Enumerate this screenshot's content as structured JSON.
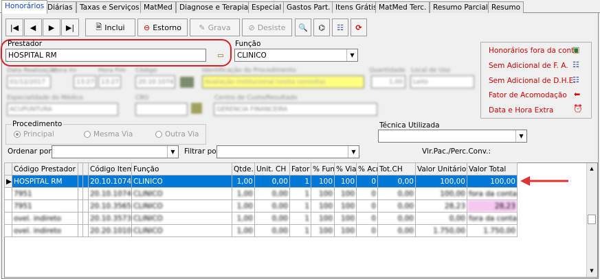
{
  "tabs": [
    "Honorários",
    "Diárias",
    "Taxas e Serviços",
    "MatMed",
    "Diagnose e Terapia",
    "Especial",
    "Gastos Part.",
    "Itens Grátis",
    "MatMed Terc.",
    "Resumo Parcial",
    "Resumo"
  ],
  "toolbar": {
    "first": "|◀",
    "prev": "◀",
    "next": "▶",
    "last": "▶|",
    "inclui": "Inclui",
    "estorno": "Estorno",
    "grava": "Grava",
    "desiste": "Desiste"
  },
  "form": {
    "prestador_label": "Prestador",
    "prestador_value": "HOSPITAL RM",
    "funcao_label": "Função",
    "funcao_value": "CLINICO",
    "data_label": "Data Realização",
    "hora_ini_label": "Hora Ini",
    "hora_fim_label": "Hora Fim",
    "codigo_label": "Código",
    "data_value": "01/12/2017",
    "hora_ini_value": "13:27",
    "hora_fim_value": "13:27",
    "codigo_value": "20.10.1074",
    "descricao_label": "Identificação do Procedimento",
    "descricao_value": "Avaliação institucional (visita consulta)",
    "quantidade_label": "Quantidade",
    "quantidade_value": "1,00",
    "local_label": "Local de Uso",
    "local_value": "Leito",
    "especialidade_label": "Especialidade do Médico",
    "especialidade_value": "ACUPUNTURA",
    "cbo_label": "CBO",
    "centro_label": "Centro de Custo/Resultado",
    "centro_value": "GERENCIA FINANCEIRA",
    "procedimento_label": "Procedimento",
    "proc_principal": "Principal",
    "proc_mesma": "Mesma Via",
    "proc_outra": "Outra Via",
    "tecnica_label": "Técnica Utilizada",
    "ordenar_label": "Ordenar por",
    "filtrar_label": "Filtrar por",
    "vlr_label": "Vlr.Pac./Perc.Conv.:"
  },
  "right_links": [
    {
      "label": "Honorários fora da conta",
      "icon": "money-icon"
    },
    {
      "label": "Sem Adicional de F. A.",
      "icon": "people-icon"
    },
    {
      "label": "Sem Adicional de D.H.E.",
      "icon": "people-icon"
    },
    {
      "label": "Fator de Acomodação",
      "icon": "arrow-left-icon"
    },
    {
      "label": "Data e Hora Extra",
      "icon": "alarm-clock-icon"
    }
  ],
  "grid": {
    "columns": [
      "Código Prestador",
      "",
      "",
      "Código Item",
      "Função",
      "Qtde.",
      "Unit. CH",
      "Fator",
      "% Fun",
      "% Via",
      "% Acr",
      "Tot.CH",
      "Valor Unitário",
      "Valor Total"
    ],
    "rows": [
      [
        "HOSPITAL RM",
        "",
        "",
        "20.10.1074",
        "CLINICO",
        "1,00",
        "0,00",
        "1",
        "100",
        "100",
        "0",
        "0,00",
        "100,00",
        "100,00"
      ],
      [
        "7951",
        "",
        "",
        "20.10.1074",
        "CLINICO",
        "1,00",
        "0,00",
        "1",
        "100",
        "100",
        "0",
        "0,00",
        "100,00",
        "fora da conta"
      ],
      [
        "7951",
        "",
        "",
        "20.10.3565",
        "CLINICO",
        "1,00",
        "0,00",
        "1",
        "100",
        "100",
        "0",
        "0,00",
        "28,23",
        "28,23"
      ],
      [
        "ovel. indireto",
        "",
        "",
        "20.10.3573",
        "CLINICO",
        "1,00",
        "0,00",
        "1",
        "100",
        "100",
        "0",
        "0,00",
        "0,00",
        "fora da conta"
      ],
      [
        "ovel. indireto",
        "",
        "",
        "20.20.1010",
        "CLINICO",
        "1,00",
        "0,00",
        "1",
        "100",
        "100",
        "0",
        "0,00",
        "1.750,00",
        "1.750,00"
      ]
    ]
  },
  "colors": {
    "accent": "#0078d7",
    "highlight": "#ffff80",
    "annotation": "#e03030",
    "link": "#cc0000"
  }
}
